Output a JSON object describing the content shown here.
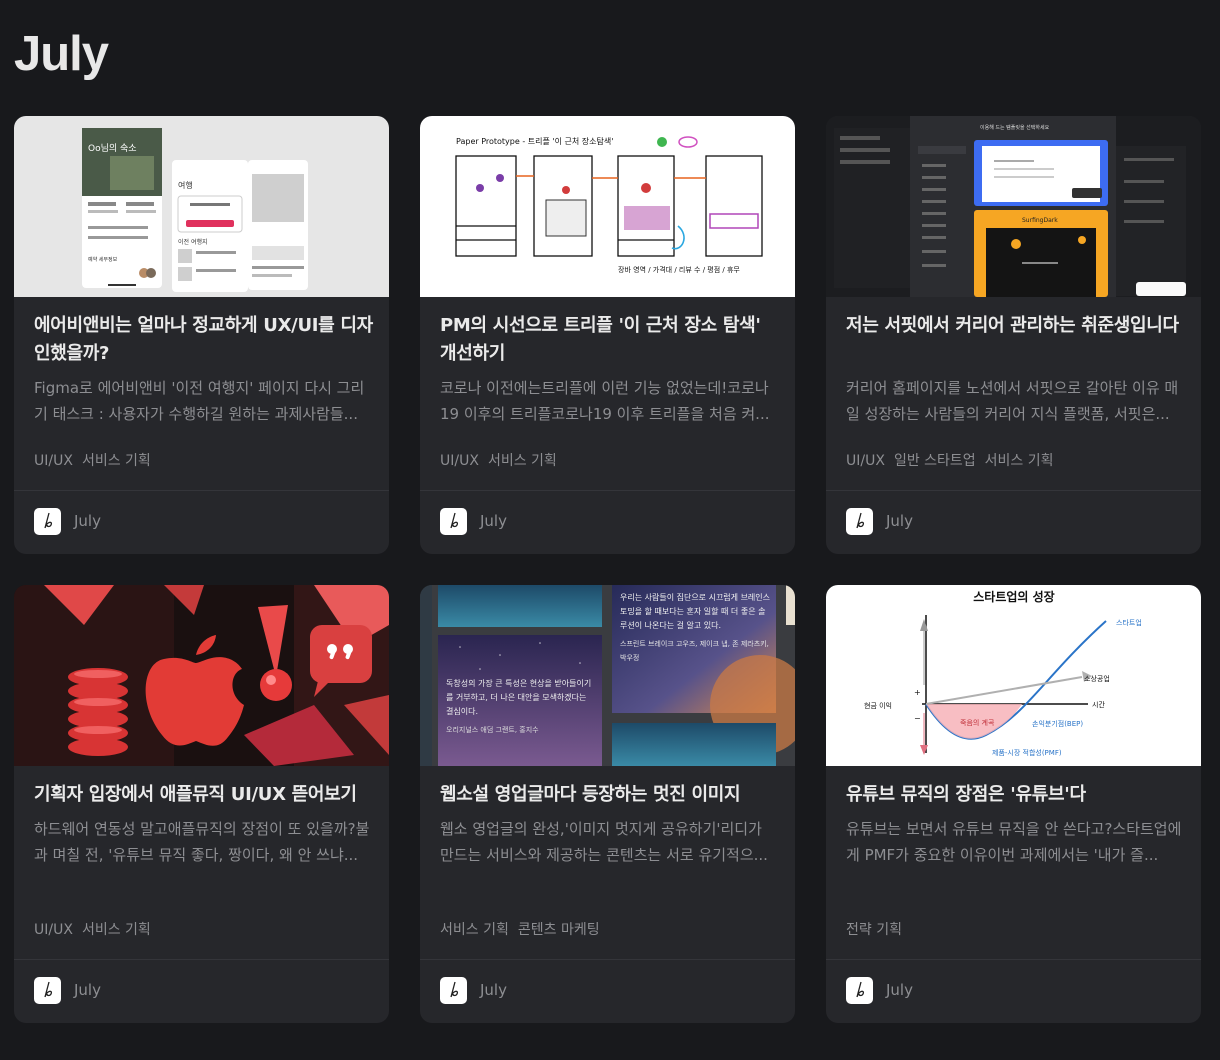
{
  "page": {
    "title": "July"
  },
  "cards": [
    {
      "title": "에어비앤비는 얼마나 정교하게 UX/UI를 디자인했을까?",
      "description": "Figma로 에어비앤비 '이전 여행지' 페이지 다시 그리기 태스크 : 사용자가 수행하길 원하는 과제사람들...",
      "tags": [
        "UI/UX",
        "서비스 기획"
      ],
      "author": "July",
      "thumb_text": {
        "phone_title": "Oo님의 숙소",
        "section_trips": "여행",
        "section_past": "이전 여행지",
        "section_reservation": "예약 세부정보"
      }
    },
    {
      "title": "PM의 시선으로 트리플 '이 근처 장소 탐색' 개선하기",
      "description": "코로나 이전에는트리플에 이런 기능 없었는데!코로나19 이후의 트리플코로나19 이후 트리플을 처음 켜...",
      "tags": [
        "UI/UX",
        "서비스 기획"
      ],
      "author": "July",
      "thumb_text": {
        "sketch_header": "Paper Prototype - 트리플 '이 근처 장소탐색'",
        "sketch_note": "장바 영역 / 가격대 / 리뷰 수 / 평점 / 휴무"
      }
    },
    {
      "title": "저는 서핏에서 커리어 관리하는 취준생입니다",
      "description": "커리어 홈페이지를 노션에서 서핏으로 갈아탄 이유 매일 성장하는 사람들의 커리어 지식 플랫폼, 서핏은...",
      "tags": [
        "UI/UX",
        "일반 스타트업",
        "서비스 기획"
      ],
      "author": "July",
      "thumb_text": {
        "modal_title": "이용해 드는 템플릿을 선택하세요",
        "theme_label": "SurfingDark"
      }
    },
    {
      "title": "기획자 입장에서 애플뮤직 UI/UX 뜯어보기",
      "description": "하드웨어 연동성 말고애플뮤직의 장점이 또 있을까?불과 며칠 전, '유튜브 뮤직 좋다, 짱이다, 왜 안 쓰냐...",
      "tags": [
        "UI/UX",
        "서비스 기획"
      ],
      "author": "July"
    },
    {
      "title": "웹소설 영업글마다 등장하는 멋진 이미지",
      "description": "웹소 영업글의 완성,'이미지 멋지게 공유하기'리디가 만드는 서비스와 제공하는 콘텐츠는 서로 유기적으...",
      "tags": [
        "서비스 기획",
        "콘텐츠 마케팅"
      ],
      "author": "July",
      "thumb_text": {
        "quote_1": "독창성의 가장 큰 특성은 현상을 받아들이기를 거부하고, 더 나은 대안을 모색하겠다는 결심이다.",
        "quote_1_source": "오리지널스 애덤 그랜트, 홍지수",
        "quote_2": "우리는 사람들이 집단으로 시끄럽게 브레인스토밍을 할 때보다는 혼자 일할 때 더 좋은 솔루션이 나온다는 걸 알고 있다.",
        "quote_2_source": "스프린트 브레이크 고우즈, 제이크 냅, 존 제라츠키, 박우정"
      }
    },
    {
      "title": "유튜브 뮤직의 장점은 '유튜브'다",
      "description": "유튜브는 보면서 유튜브 뮤직을 안 쓴다고?스타트업에게 PMF가 중요한 이유이번 과제에서는 '내가 즐...",
      "tags": [
        "전략 기획"
      ],
      "author": "July",
      "thumb_text": {
        "chart_title": "스타트업의 성장",
        "startup": "스타트업",
        "small_business": "소상공업",
        "time": "시간",
        "cash": "현금 이익",
        "plus": "+",
        "minus": "−",
        "valley": "죽음의 계곡",
        "bep": "손익분기점(BEP)",
        "pmf": "제품-시장 적합성(PMF)"
      }
    }
  ],
  "colors": {
    "background": "#18191c",
    "card": "#26272b",
    "muted_text": "#8d8e92",
    "title_text": "#eaeaea"
  }
}
